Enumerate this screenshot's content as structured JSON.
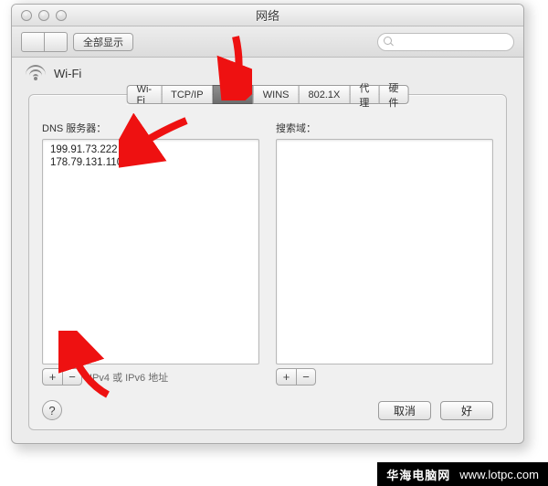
{
  "window": {
    "title": "网络"
  },
  "toolbar": {
    "show_all": "全部显示"
  },
  "wifi": {
    "label": "Wi-Fi"
  },
  "tabs": [
    {
      "label": "Wi-Fi"
    },
    {
      "label": "TCP/IP"
    },
    {
      "label": "DNS"
    },
    {
      "label": "WINS"
    },
    {
      "label": "802.1X"
    },
    {
      "label": "代理"
    },
    {
      "label": "硬件"
    }
  ],
  "active_tab_index": 2,
  "dns": {
    "label": "DNS 服务器：",
    "entries": [
      "199.91.73.222",
      "178.79.131.110"
    ],
    "hint": "IPv4 或 IPv6 地址"
  },
  "search_domains": {
    "label": "搜索域："
  },
  "actions": {
    "cancel": "取消",
    "ok": "好"
  },
  "icons": {
    "plus": "+",
    "minus": "−",
    "help": "?"
  },
  "watermark": {
    "zh": "华海电脑网",
    "url": "www.lotpc.com"
  },
  "arrow_color": "#e11"
}
